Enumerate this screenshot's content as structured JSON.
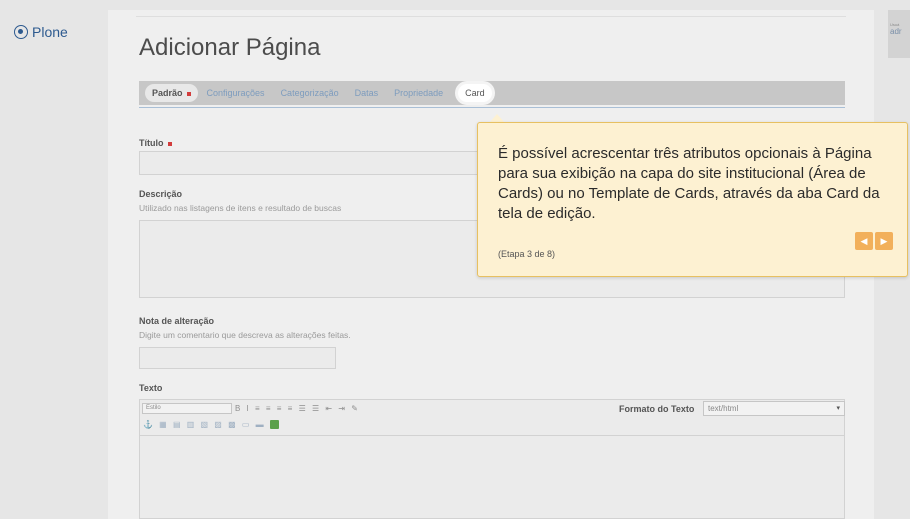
{
  "brand": {
    "logo_text": "Plone"
  },
  "user": {
    "label_small": "Usuá",
    "name": "adr"
  },
  "page": {
    "title": "Adicionar Página"
  },
  "tabs": [
    {
      "label": "Padrão",
      "required": true,
      "state": "active"
    },
    {
      "label": "Configurações"
    },
    {
      "label": "Categorização"
    },
    {
      "label": "Datas"
    },
    {
      "label": "Propriedade"
    },
    {
      "label": "Card",
      "state": "highlighted"
    }
  ],
  "form": {
    "titulo": {
      "label": "Título",
      "required": true,
      "value": ""
    },
    "descricao": {
      "label": "Descrição",
      "help": "Utilizado nas listagens de itens e resultado de buscas",
      "value": ""
    },
    "nota": {
      "label": "Nota de alteração",
      "help": "Digite um comentario que descreva as alterações feitas.",
      "value": ""
    },
    "texto": {
      "label": "Texto",
      "style_select": "Estilo",
      "format_label": "Formato do Texto",
      "format_value": "text/html"
    }
  },
  "tour": {
    "message": "É possível acrescentar três atributos opcionais à Página para sua exibição na capa do site institucional (Área de Cards) ou no Template de Cards, através da aba Card da tela de edição.",
    "step": "(Etapa 3 de 8)",
    "prev_icon": "caret-left-icon",
    "next_icon": "caret-right-icon"
  },
  "colors": {
    "accent_link": "#7d9cbe",
    "required": "#d23c3c",
    "tour_bg": "#fdf1d2",
    "tour_nav": "#f2b05b"
  }
}
